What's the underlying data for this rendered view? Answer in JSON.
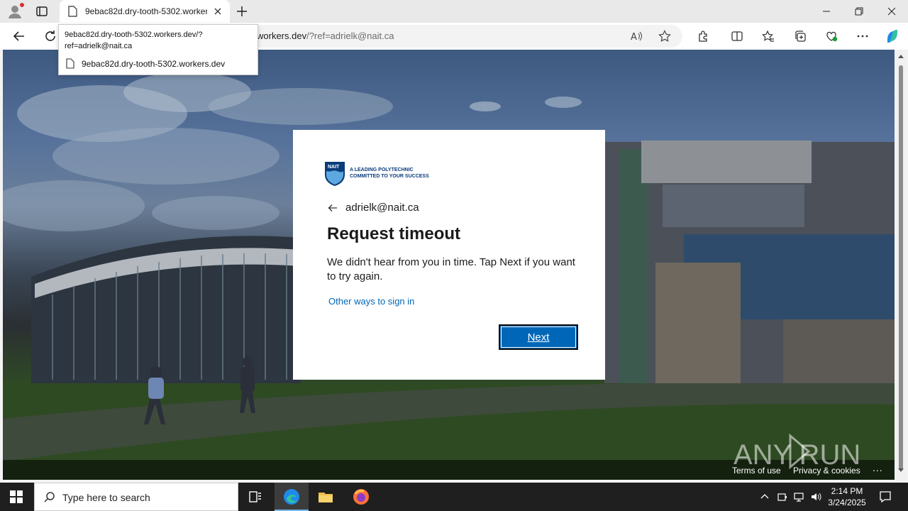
{
  "browser": {
    "tab_title": "9ebac82d.dry-tooth-5302.workers.dev",
    "address_visible": "workers.dev",
    "address_query": "/?ref=adrielk@nait.ca",
    "tooltip": {
      "url": "9ebac82d.dry-tooth-5302.workers.dev/?ref=adrielk@nait.ca",
      "host": "9ebac82d.dry-tooth-5302.workers.dev"
    }
  },
  "login": {
    "logo_tagline_1": "A LEADING POLYTECHNIC",
    "logo_tagline_2": "COMMITTED TO YOUR SUCCESS",
    "logo_mark": "NAIT",
    "email": "adrielk@nait.ca",
    "heading": "Request timeout",
    "message": "We didn't hear from you in time. Tap Next if you want to try again.",
    "other_ways": "Other ways to sign in",
    "next_label": "Next"
  },
  "footer": {
    "terms": "Terms of use",
    "privacy": "Privacy & cookies",
    "more": "..."
  },
  "watermark": "ANY RUN",
  "taskbar": {
    "search_placeholder": "Type here to search",
    "time": "2:14 PM",
    "date": "3/24/2025"
  },
  "colors": {
    "accent": "#0067b8",
    "nait_blue": "#0b3c7a",
    "taskbar": "#1f1f1f"
  }
}
